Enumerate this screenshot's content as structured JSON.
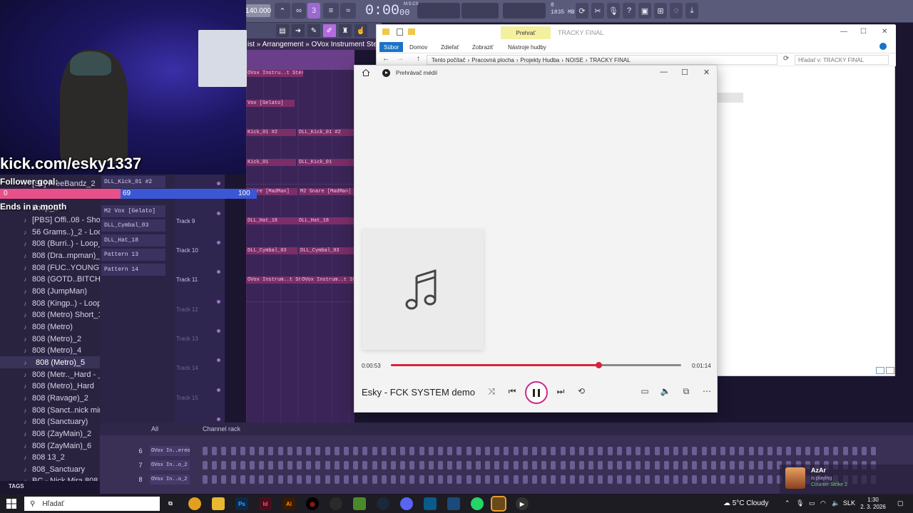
{
  "fl": {
    "bpm": "140.000",
    "time": "0:00",
    "time_small": "00",
    "time_unit": "M:S:CS",
    "memory": "1835 MB",
    "memory_sub": "0",
    "arrangement_label": "ist » Arrangement » OVox Instrument Stereo",
    "browser_items": [
      "[SL] FreeBandz_2",
      "",
      "Loop_2",
      "[PBS] Offi..08 - Short",
      "56 Grams..)_2 - Loop",
      "808 (Burri..) - Loop_2",
      "808 (Dra..mpman)_2",
      "808 (FUC..YOUNG)_2",
      "808 (GOTD..BITCH)_5",
      "808 (JumpMan)",
      "808 (Kingp..) - Loop 3",
      "808 (Metro) Short_1",
      "808 (Metro)",
      "808 (Metro)_2",
      "808 (Metro)_4",
      "808 (Metro)_5",
      "808 (Metr.._Hard - _2",
      "808 (Metro)_Hard",
      "808 (Ravage)_2",
      "808 (Sanct..nick mira",
      "808 (Sanctuary)",
      "808 (ZayMain)_2",
      "808 (ZayMain)_6",
      "808 13_2",
      "808_Sanctuary",
      "BC - Nick Mira 808"
    ],
    "channels": [
      "DLL_Kick_01 #2",
      "",
      "M2 Vox [Gelato]",
      "DLL_Cymbal_03",
      "DLL_Hat_18",
      "Pattern 13",
      "Pattern 14"
    ],
    "tracks": [
      "Track 9",
      "Track 10",
      "Track 11",
      "Track 12",
      "Track 13",
      "Track 14",
      "Track 15"
    ],
    "clips": [
      "OVox Instru..t Stereo_2 #3",
      "Vox [Gelato]",
      "Kick_01 #2",
      "DLL_Kick_01 #2",
      "Kick_01",
      "DLL_Kick_01",
      "Snare [MadMan]",
      "M2 Snare [MadMan]",
      "DLL_Hat_18",
      "DLL_Hat_18",
      "DLL_Cymbal_03",
      "DLL_Cymbal_03",
      "OVox Instrum..t Stereo_2 #6",
      "OVox Instrum..t Stereo_2"
    ],
    "rack_filter": "All",
    "rack_title": "Channel rack",
    "rack_rows": [
      {
        "num": "6",
        "label": "OVox In..ereo_2"
      },
      {
        "num": "7",
        "label": "OVox In..o_2 #3"
      },
      {
        "num": "8",
        "label": "OVox In..o_2 #2"
      }
    ],
    "tags_label": "TAGS"
  },
  "overlay": {
    "url": "kick.com/esky1337",
    "goal_label": "Follower goal:",
    "goal_start": "0",
    "goal_current": "69",
    "goal_end": "100",
    "goal_fraction": 0.69,
    "ends": "Ends in a month"
  },
  "explorer": {
    "title": "TRACKY FINAL",
    "play_tab": "Prehrať",
    "tabs": [
      "Súbor",
      "Domov",
      "Zdieľať",
      "Zobraziť",
      "Nástroje hudby"
    ],
    "path": [
      "Tento počítač",
      "Pracovná plocha",
      "Projekty Hudba",
      "NOISE",
      "TRACKY FINAL"
    ],
    "search_placeholder": "Hľadať v: TRACKY FINAL"
  },
  "player": {
    "title": "Prehrávač médií",
    "song": "Esky - FCK SYSTEM demo",
    "time_current": "0:00:53",
    "time_total": "0:01:14",
    "progress": 0.716
  },
  "alert": {
    "name": "AzAr",
    "status": "is playing",
    "game": "Counter-Strike 2"
  },
  "taskbar": {
    "search_placeholder": "Hľadať",
    "weather": "5°C  Cloudy",
    "lang": "SLK",
    "time": "1:30",
    "date": "2. 3. 2026"
  },
  "colors": {
    "accent_player": "#d6253a",
    "explorer_blue": "#1a73c7",
    "goal_pink": "#e8508a",
    "goal_blue": "#3a58d6"
  }
}
